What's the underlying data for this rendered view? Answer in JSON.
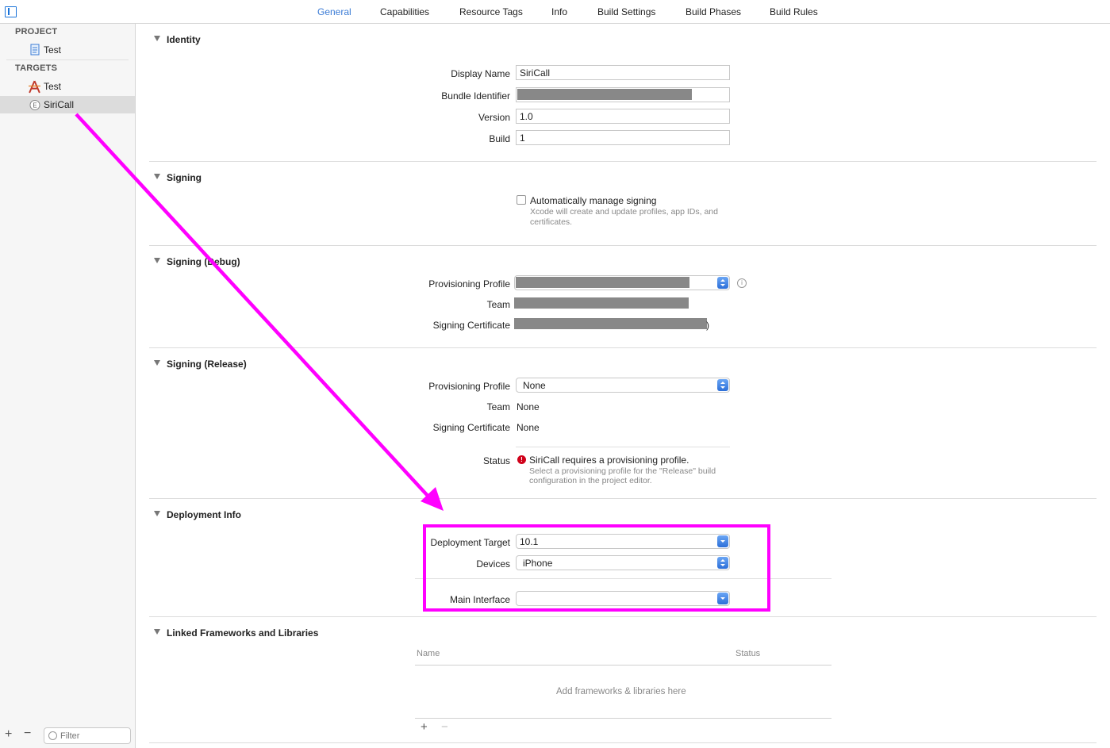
{
  "tabs": [
    {
      "label": "General",
      "active": true
    },
    {
      "label": "Capabilities",
      "active": false
    },
    {
      "label": "Resource Tags",
      "active": false
    },
    {
      "label": "Info",
      "active": false
    },
    {
      "label": "Build Settings",
      "active": false
    },
    {
      "label": "Build Phases",
      "active": false
    },
    {
      "label": "Build Rules",
      "active": false
    }
  ],
  "sidebar": {
    "project_header": "PROJECT",
    "project_item": "Test",
    "targets_header": "TARGETS",
    "targets": [
      {
        "label": "Test",
        "icon": "app-target-icon"
      },
      {
        "label": "SiriCall",
        "icon": "extension-target-icon",
        "selected": true
      }
    ],
    "filter_placeholder": "Filter"
  },
  "identity": {
    "title": "Identity",
    "display_name_label": "Display Name",
    "display_name": "SiriCall",
    "bundle_identifier_label": "Bundle Identifier",
    "version_label": "Version",
    "version": "1.0",
    "build_label": "Build",
    "build": "1"
  },
  "signing": {
    "title": "Signing",
    "auto_label": "Automatically manage signing",
    "auto_help_1": "Xcode will create and update profiles, app IDs, and",
    "auto_help_2": "certificates."
  },
  "signing_debug": {
    "title": "Signing (Debug)",
    "profile_label": "Provisioning Profile",
    "team_label": "Team",
    "cert_label": "Signing Certificate",
    "cert_suffix": ")"
  },
  "signing_release": {
    "title": "Signing (Release)",
    "profile_label": "Provisioning Profile",
    "profile_value": "None",
    "team_label": "Team",
    "team_value": "None",
    "cert_label": "Signing Certificate",
    "cert_value": "None",
    "status_label": "Status",
    "status_message": "SiriCall requires a provisioning profile.",
    "status_help_1": "Select a provisioning profile for the \"Release\" build",
    "status_help_2": "configuration in the project editor."
  },
  "deployment": {
    "title": "Deployment Info",
    "target_label": "Deployment Target",
    "target_value": "10.1",
    "devices_label": "Devices",
    "devices_value": "iPhone",
    "main_interface_label": "Main Interface",
    "main_interface_value": ""
  },
  "frameworks": {
    "title": "Linked Frameworks and Libraries",
    "col_name": "Name",
    "col_status": "Status",
    "empty_message": "Add frameworks & libraries here",
    "add_symbol": "+",
    "remove_symbol": "−"
  },
  "colors": {
    "accent": "#3a7bd5",
    "annotation": "#ff00ff",
    "error": "#d0021b"
  }
}
